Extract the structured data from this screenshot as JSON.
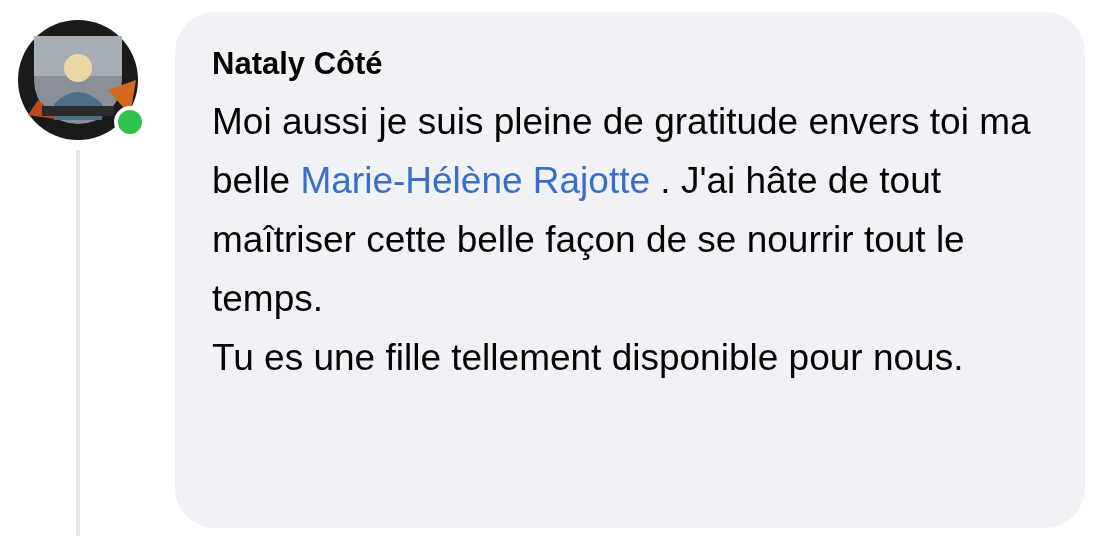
{
  "comment": {
    "author": "Nataly Côté",
    "online": true,
    "avatar": {
      "kind": "picture"
    },
    "paragraphs": [
      [
        {
          "kind": "text",
          "text": "Moi aussi je suis pleine de gratitude envers toi ma belle "
        },
        {
          "kind": "mention",
          "text": "Marie-Hélène Rajotte"
        },
        {
          "kind": "text",
          "text": " . J'ai hâte de tout maîtriser cette belle façon de se nourrir tout le temps."
        }
      ],
      [
        {
          "kind": "text",
          "text": "Tu es une fille tellement disponible pour nous."
        }
      ]
    ]
  }
}
